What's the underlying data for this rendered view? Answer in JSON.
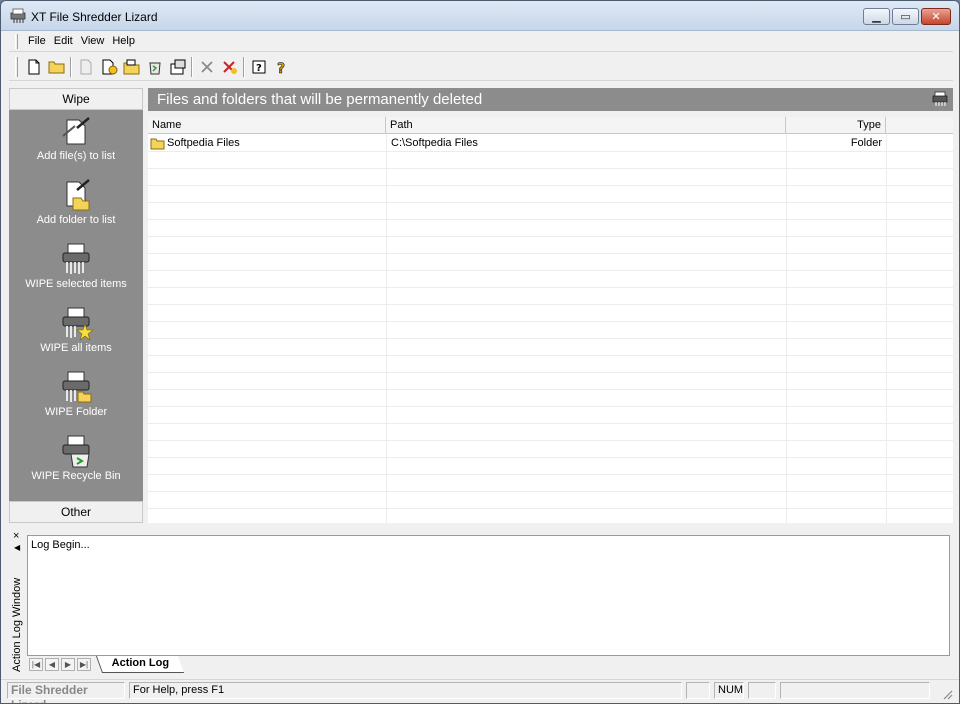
{
  "window": {
    "title": "XT File Shredder Lizard"
  },
  "menu": [
    "File",
    "Edit",
    "View",
    "Help"
  ],
  "left_panel": {
    "header": "Wipe",
    "footer": "Other",
    "items": [
      {
        "label": "Add file(s) to list",
        "icon": "add-file-icon"
      },
      {
        "label": "Add folder to list",
        "icon": "add-folder-icon"
      },
      {
        "label": "WIPE selected items",
        "icon": "shredder-icon"
      },
      {
        "label": "WIPE all items",
        "icon": "shredder-star-icon"
      },
      {
        "label": "WIPE Folder",
        "icon": "shredder-folder-icon"
      },
      {
        "label": "WIPE Recycle Bin",
        "icon": "shredder-recycle-icon"
      }
    ]
  },
  "files_panel": {
    "header": "Files and folders that will be permanently deleted",
    "columns": {
      "name": "Name",
      "path": "Path",
      "type": "Type"
    },
    "rows": [
      {
        "name": "Softpedia Files",
        "path": "C:\\Softpedia Files",
        "type": "Folder"
      }
    ]
  },
  "log": {
    "side_label": "Action Log Window",
    "close": "×",
    "lines": [
      "Log Begin..."
    ],
    "tab": "Action Log"
  },
  "status": {
    "app_name": "File Shredder Lizard",
    "help": "For Help, press F1",
    "num": "NUM"
  },
  "colors": {
    "panel_gray": "#8c8c8c",
    "titlebar": "#dfe9f5",
    "close_red": "#c4452d"
  }
}
